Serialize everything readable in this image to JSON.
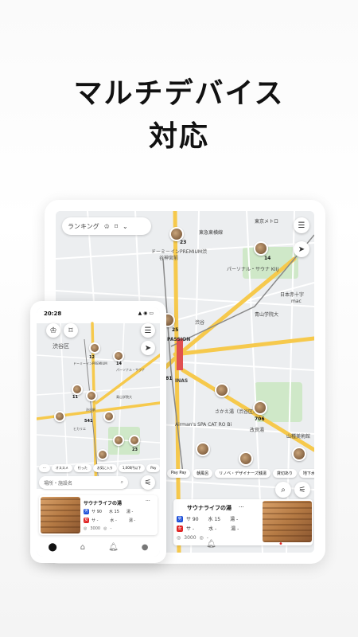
{
  "headline": {
    "line1": "マルチデバイス",
    "line2": "対応"
  },
  "tablet": {
    "top_bar": {
      "ranking_label": "ランキング",
      "crown_icon": "crown-icon",
      "bookmark_icon": "bookmark-icon",
      "dropdown_icon": "chevron-down-icon"
    },
    "map_labels": {
      "station_area": "東急東横線",
      "premium": "ドーミーインPREMIUM渋",
      "sub_premium": "谷神宮前",
      "personal_sauna": "パーソナル・サウナ KIIJ",
      "passion": "PASSION",
      "shibuya": "渋谷",
      "aoyama": "青山学院大",
      "airman": "Airman's SPA CAT RO Bi",
      "kaiten": "改良湯",
      "kawaiyu": "さかえ湯（渋谷区）",
      "mlabel": "mac",
      "yamatane": "山種美術館",
      "hiroo": "日本赤十字",
      "inas": "INAS",
      "east": "東京メトロ"
    },
    "map_numbers": [
      "23",
      "14",
      "25",
      "581",
      "706"
    ],
    "chips": [
      "Pay Pay",
      "朝風呂",
      "リノベ・デザイナーズ銭湯",
      "貸切あり",
      "地下水が汗目当て"
    ],
    "card": {
      "title": "サウナライフの湯",
      "more_icon": "more-horizontal-icon",
      "row1": [
        "サ",
        "水",
        "湯"
      ],
      "row2": [
        "サ",
        "水",
        "湯"
      ],
      "price": "3000",
      "dash": "-"
    },
    "tabbar_icons": [
      "bell-icon",
      "bell-badge-icon"
    ]
  },
  "phone": {
    "status": {
      "time": "20:28",
      "signal": "▲ ◉ ▭"
    },
    "map_labels": {
      "shibuya_ku": "渋谷区",
      "aoyama": "青山学院大",
      "hikari": "ヒカリエ",
      "dome": "ドーミーインPREMIUM",
      "shibuyaeki": "渋谷駅",
      "personal": "パーソナル・サウナ"
    },
    "map_numbers": [
      "12",
      "11",
      "14",
      "541",
      "23"
    ],
    "chips": [
      "オススメ",
      "行った",
      "お気に入り",
      "1,000円以下",
      "Pay"
    ],
    "search_placeholder": "場所・施設名",
    "card": {
      "title": "サウナライフの湯",
      "row1": [
        "サ 90",
        "水 15",
        "湯 -"
      ],
      "row2": [
        "サ -",
        "水 -",
        "湯 -"
      ],
      "price": "3000",
      "dash": "-"
    },
    "tabbar_icons": [
      "map-pin-icon",
      "home-icon",
      "bell-icon",
      "profile-icon"
    ]
  },
  "tablet_card": {
    "row1": [
      "サ 90",
      "水 15",
      "湯 -"
    ],
    "row2": [
      "サ -",
      "水 -",
      "湯 -"
    ]
  },
  "colors": {
    "map_bg": "#eceef0",
    "road_major": "#f6c94c",
    "park": "#cfe8c8",
    "water": "#b9d6f2",
    "badge_blue": "#1d4fd8",
    "badge_red": "#e02424"
  }
}
